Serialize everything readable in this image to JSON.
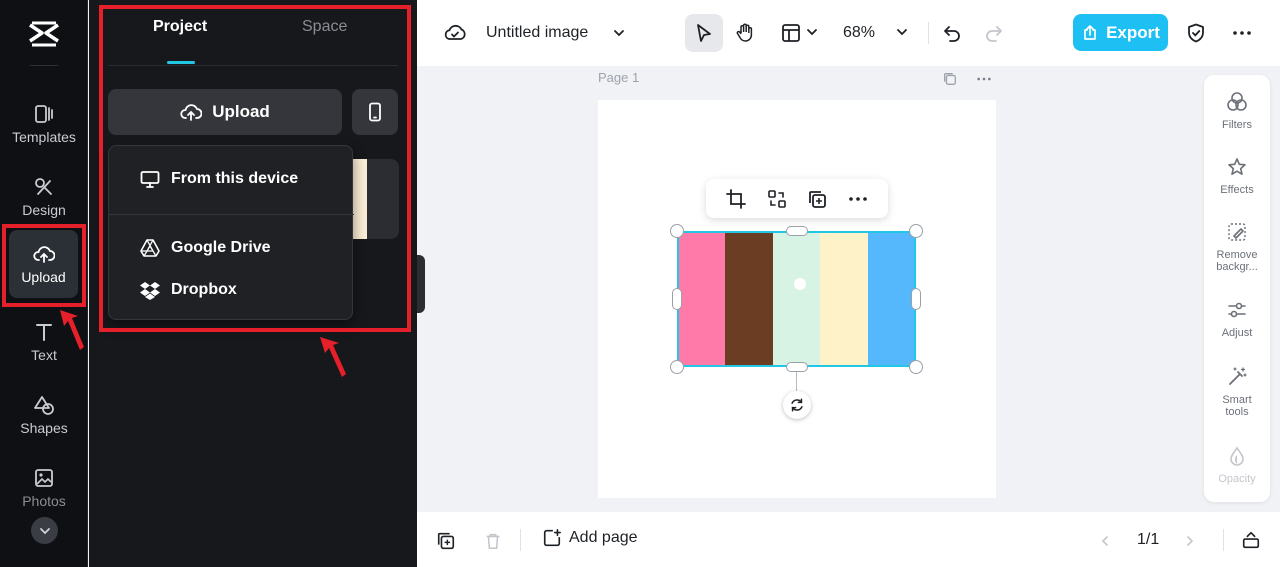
{
  "rail": {
    "items": [
      {
        "label": "Templates",
        "icon": "templates-icon"
      },
      {
        "label": "Design",
        "icon": "design-icon"
      },
      {
        "label": "Upload",
        "icon": "upload-cloud-icon"
      },
      {
        "label": "Text",
        "icon": "text-icon"
      },
      {
        "label": "Shapes",
        "icon": "shapes-icon"
      },
      {
        "label": "Photos",
        "icon": "photos-icon"
      }
    ]
  },
  "panel": {
    "tabs": [
      "Project",
      "Space"
    ],
    "upload_label": "Upload",
    "dropdown": {
      "from_device": "From this device",
      "google_drive": "Google Drive",
      "dropbox": "Dropbox"
    }
  },
  "topbar": {
    "title": "Untitled image",
    "zoom": "68%",
    "export_label": "Export"
  },
  "canvas": {
    "page_label": "Page 1",
    "image_stripes": [
      "#ff7aa8",
      "#6b3d22",
      "#d7f3e3",
      "#fdf2c8",
      "#55b8fd"
    ]
  },
  "right_tools": {
    "filters": "Filters",
    "effects": "Effects",
    "remove_bg": "Remove backgr...",
    "adjust": "Adjust",
    "smart_tools": "Smart tools",
    "opacity": "Opacity"
  },
  "bottombar": {
    "add_page": "Add page",
    "page_count": "1/1"
  },
  "colors": {
    "accent": "#1ec0f3",
    "annotation": "#e5202a"
  }
}
